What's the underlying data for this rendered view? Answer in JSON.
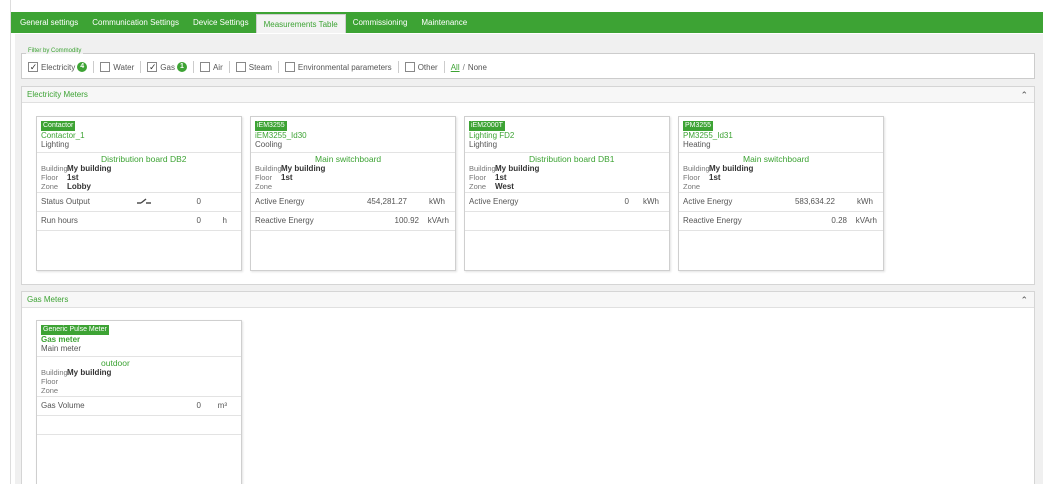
{
  "tabs": [
    {
      "label": "General settings"
    },
    {
      "label": "Communication Settings"
    },
    {
      "label": "Device Settings"
    },
    {
      "label": "Measurements Table",
      "active": true
    },
    {
      "label": "Commissioning"
    },
    {
      "label": "Maintenance"
    }
  ],
  "filter": {
    "legend": "Filter by Commodity",
    "items": [
      {
        "label": "Electricity",
        "checked": true,
        "count": "4"
      },
      {
        "label": "Water",
        "checked": false
      },
      {
        "label": "Gas",
        "checked": true,
        "count": "1"
      },
      {
        "label": "Air",
        "checked": false
      },
      {
        "label": "Steam",
        "checked": false
      },
      {
        "label": "Environmental parameters",
        "checked": false
      },
      {
        "label": "Other",
        "checked": false
      }
    ],
    "all_label": "All",
    "none_label": "None"
  },
  "electricity": {
    "title": "Electricity Meters",
    "meters": [
      {
        "type": "Contactor",
        "name": "Contactor_1",
        "usage": "Lighting",
        "location": "Distribution board DB2",
        "building_key": "Building",
        "building": "My building",
        "floor_key": "Floor",
        "floor": "1st",
        "zone_key": "Zone",
        "zone": "Lobby",
        "rows": [
          {
            "label": "Status Output",
            "value": "0",
            "unit": "",
            "icon": "switch-open-icon"
          },
          {
            "label": "Run hours",
            "value": "0",
            "unit": "h"
          }
        ]
      },
      {
        "type": "iEM3255",
        "name": "iEM3255_Id30",
        "usage": "Cooling",
        "location": "Main switchboard",
        "building_key": "Building",
        "building": "My building",
        "floor_key": "Floor",
        "floor": "1st",
        "zone_key": "Zone",
        "zone": "",
        "rows": [
          {
            "label": "Active Energy",
            "value": "454,281.27",
            "unit": "kWh"
          },
          {
            "label": "Reactive Energy",
            "value": "100.92",
            "unit": "kVArh"
          }
        ]
      },
      {
        "type": "iEM2000T",
        "name": "Lighting FD2",
        "usage": "Lighting",
        "location": "Distribution board DB1",
        "building_key": "Building",
        "building": "My building",
        "floor_key": "Floor",
        "floor": "1st",
        "zone_key": "Zone",
        "zone": "West",
        "rows": [
          {
            "label": "Active Energy",
            "value": "0",
            "unit": "kWh"
          }
        ]
      },
      {
        "type": "PM3255",
        "name": "PM3255_Id31",
        "usage": "Heating",
        "location": "Main switchboard",
        "building_key": "Building",
        "building": "My building",
        "floor_key": "Floor",
        "floor": "1st",
        "zone_key": "Zone",
        "zone": "",
        "rows": [
          {
            "label": "Active Energy",
            "value": "583,634.22",
            "unit": "kWh"
          },
          {
            "label": "Reactive Energy",
            "value": "0.28",
            "unit": "kVArh"
          }
        ]
      }
    ]
  },
  "gas": {
    "title": "Gas Meters",
    "meters": [
      {
        "type": "Generic Pulse Meter",
        "name": "Gas meter",
        "usage": "Main meter",
        "location": "outdoor",
        "building_key": "Building",
        "building": "My building",
        "floor_key": "Floor",
        "floor": "",
        "zone_key": "Zone",
        "zone": "",
        "rows": [
          {
            "label": "Gas Volume",
            "value": "0",
            "unit": "m³"
          }
        ]
      }
    ]
  },
  "colors": {
    "accent": "#3da334",
    "panel": "#f0f0f0"
  }
}
